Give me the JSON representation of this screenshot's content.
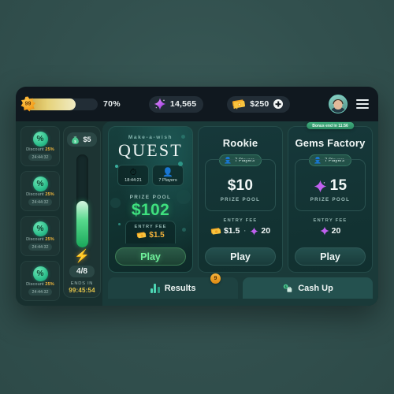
{
  "header": {
    "xp": {
      "level": "99",
      "percent_label": "70%",
      "percent_value": 70,
      "icon": "star-badge-icon"
    },
    "gems": {
      "value": "14,565",
      "icon": "gem-icon"
    },
    "cash": {
      "value": "$250",
      "icon": "money-stack-icon",
      "add_icon": "plus-icon"
    },
    "avatar": "user-avatar",
    "menu_icon": "hamburger-menu-icon"
  },
  "discount_cards": [
    {
      "icon": "discount-tag-icon",
      "label": "Discount",
      "percent": "25%",
      "timer": "24:44:32"
    },
    {
      "icon": "discount-tag-icon",
      "label": "Discount",
      "percent": "25%",
      "timer": "24:44:32"
    },
    {
      "icon": "discount-tag-icon",
      "label": "Discount",
      "percent": "25%",
      "timer": "24:44:32"
    },
    {
      "icon": "discount-tag-icon",
      "label": "Discount",
      "percent": "25%",
      "timer": "24:44:32"
    }
  ],
  "energy": {
    "money_icon": "money-bag-icon",
    "money_value": "$5",
    "bolt_icon": "lightning-bolt-icon",
    "fill_percent": 50,
    "fraction": "4/8",
    "ends_in_label": "ENDS IN",
    "ends_in_value": "99:45:54"
  },
  "cards": {
    "quest": {
      "kicker": "Make-a-wish",
      "title": "QUEST",
      "stats": [
        {
          "icon": "stopwatch-icon",
          "text": "18:44:21"
        },
        {
          "icon": "player-icon",
          "text": "7 Players"
        }
      ],
      "prize_label": "PRIZE POOL",
      "prize_value": "$102",
      "fee_label": "ENTRY FEE",
      "fee_icon": "money-stack-icon",
      "fee_value": "$1.5",
      "play_label": "Play"
    },
    "rookie": {
      "title": "Rookie",
      "players_icon": "player-icon",
      "players_text": "7 Players",
      "prize_value": "$10",
      "prize_label": "PRIZE POOL",
      "fee_label": "ENTRY FEE",
      "fee_cash_icon": "money-stack-icon",
      "fee_cash": "$1.5",
      "fee_separator": "·",
      "fee_gem_icon": "gem-icon",
      "fee_gems": "20",
      "play_label": "Play"
    },
    "gems_factory": {
      "bonus_badge": "Bonus end in 11:56",
      "title": "Gems Factory",
      "players_icon": "player-icon",
      "players_text": "7 Players",
      "prize_icon": "gem-icon",
      "prize_value": "15",
      "prize_label": "PRIZE POOL",
      "fee_label": "ENTRY FEE",
      "fee_gem_icon": "gem-icon",
      "fee_gems": "20",
      "play_label": "Play"
    }
  },
  "tabs": [
    {
      "label": "Results",
      "icon": "bar-chart-icon",
      "badge": "9"
    },
    {
      "label": "Cash Up",
      "icon": "cash-up-icon",
      "badge": null
    }
  ],
  "colors": {
    "background": "#33504e",
    "panel": "#1a3a39",
    "header": "#10181f",
    "accent_green": "#3ee07e",
    "accent_gem": "#c06ef0",
    "accent_gold": "#f3b23c"
  }
}
